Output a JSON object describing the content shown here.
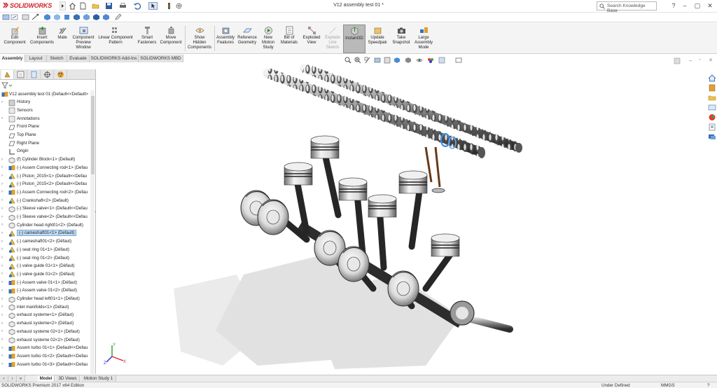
{
  "app": {
    "logo_text": "SOLIDWORKS",
    "document_title": "V12 assembly test 01 *",
    "search_placeholder": "Search Knowledge Base",
    "window_controls": [
      "?",
      "–",
      "▢",
      "✕"
    ]
  },
  "quick_access_icons": [
    "home-icon",
    "new-document-icon",
    "open-icon",
    "save-icon",
    "print-icon",
    "undo-icon",
    "select-icon",
    "rebuild-icon",
    "options-icon"
  ],
  "ribbon": {
    "buttons": [
      {
        "label": "Edit\nComponent",
        "icon": "edit-component-icon",
        "enabled": true
      },
      {
        "label": "Insert\nComponents",
        "icon": "insert-components-icon",
        "enabled": true
      },
      {
        "label": "Mate",
        "icon": "mate-icon",
        "enabled": true
      },
      {
        "label": "Component\nPreview\nWindow",
        "icon": "component-preview-icon",
        "enabled": true
      },
      {
        "label": "Linear Component\nPattern",
        "icon": "linear-pattern-icon",
        "enabled": true
      },
      {
        "label": "Smart\nFasteners",
        "icon": "smart-fasteners-icon",
        "enabled": true
      },
      {
        "label": "Move\nComponent",
        "icon": "move-component-icon",
        "enabled": true
      },
      {
        "label": "Show\nHidden\nComponents",
        "icon": "show-hidden-icon",
        "enabled": true
      },
      {
        "label": "Assembly\nFeatures",
        "icon": "assembly-features-icon",
        "enabled": true
      },
      {
        "label": "Reference\nGeometry",
        "icon": "reference-geometry-icon",
        "enabled": true
      },
      {
        "label": "New\nMotion\nStudy",
        "icon": "motion-study-icon",
        "enabled": true
      },
      {
        "label": "Bill of\nMaterials",
        "icon": "bom-icon",
        "enabled": true
      },
      {
        "label": "Exploded\nView",
        "icon": "exploded-view-icon",
        "enabled": true
      },
      {
        "label": "Explode\nLine\nSketch",
        "icon": "explode-line-icon",
        "enabled": false
      },
      {
        "label": "Instant3D",
        "icon": "instant3d-icon",
        "enabled": true,
        "active": true
      },
      {
        "label": "Update\nSpeedpak",
        "icon": "speedpak-icon",
        "enabled": true
      },
      {
        "label": "Take\nSnapshot",
        "icon": "snapshot-icon",
        "enabled": true
      },
      {
        "label": "Large\nAssembly\nMode",
        "icon": "large-assembly-icon",
        "enabled": true
      }
    ]
  },
  "command_tabs": [
    {
      "label": "Assembly",
      "active": true
    },
    {
      "label": "Layout",
      "active": false
    },
    {
      "label": "Sketch",
      "active": false
    },
    {
      "label": "Evaluate",
      "active": false
    },
    {
      "label": "SOLIDWORKS Add-Ins",
      "active": false
    },
    {
      "label": "SOLIDWORKS MBD",
      "active": false
    }
  ],
  "feature_tree": {
    "root": "V12 assembly test 01  (Default<<Default>",
    "items": [
      {
        "label": "History",
        "icon": "history-folder-icon",
        "expand": true
      },
      {
        "label": "Sensors",
        "icon": "sensors-icon",
        "expand": false
      },
      {
        "label": "Annotations",
        "icon": "annotations-icon",
        "expand": true
      },
      {
        "label": "Front Plane",
        "icon": "plane-icon",
        "expand": false
      },
      {
        "label": "Top Plane",
        "icon": "plane-icon",
        "expand": false
      },
      {
        "label": "Right Plane",
        "icon": "plane-icon",
        "expand": false
      },
      {
        "label": "Origin",
        "icon": "origin-icon",
        "expand": false
      },
      {
        "label": "(f) Cylinder Block<1> (Default)",
        "icon": "part-icon",
        "expand": true
      },
      {
        "label": "(-) Assem Connecting rod<1> (Defau",
        "icon": "assembly-icon",
        "expand": true
      },
      {
        "label": "(-) Piston_2015<1> (Default<<Defau",
        "icon": "part-warning-icon",
        "expand": true
      },
      {
        "label": "(-) Piston_2015<2> (Default<<Defau",
        "icon": "part-warning-icon",
        "expand": true
      },
      {
        "label": "(-) Assem Connecting rod<2> (Defau",
        "icon": "assembly-icon",
        "expand": true
      },
      {
        "label": "(-) Crankshaft<2> (Default)",
        "icon": "part-warning-icon",
        "expand": true
      },
      {
        "label": "(-) Sleeve valve<1> (Default<<Defau",
        "icon": "part-icon",
        "expand": true
      },
      {
        "label": "(-) Sleeve valve<2> (Default<<Defau",
        "icon": "part-icon",
        "expand": true
      },
      {
        "label": "Cylinder head right01<2> (Default)",
        "icon": "part-icon",
        "expand": true
      },
      {
        "label": "(-) cameshaft01<1> (Default)",
        "icon": "part-warning-icon",
        "expand": true,
        "selected": true
      },
      {
        "label": "(-) cameshaft01<2> (Défaut)",
        "icon": "part-warning-icon",
        "expand": true
      },
      {
        "label": "(-) seat ring 01<1> (Défaut)",
        "icon": "part-warning-icon",
        "expand": true
      },
      {
        "label": "(-) seat ring 01<2> (Défaut)",
        "icon": "part-warning-icon",
        "expand": true
      },
      {
        "label": "(-) valve guide 01<1> (Défaut)",
        "icon": "part-warning-icon",
        "expand": true
      },
      {
        "label": "(-) valve guide 01<2> (Défaut)",
        "icon": "part-warning-icon",
        "expand": true
      },
      {
        "label": "(-) Assem valve 01<1> (Défaut)",
        "icon": "assembly-icon",
        "expand": true
      },
      {
        "label": "(-) Assem valve 01<2> (Défaut)",
        "icon": "assembly-icon",
        "expand": true
      },
      {
        "label": "Cylinder head left01<1> (Défaut)",
        "icon": "part-icon",
        "expand": true
      },
      {
        "label": "inlet manifolds<1> (Défaut)",
        "icon": "part-icon",
        "expand": true
      },
      {
        "label": "exhaust systeme<1> (Défaut)",
        "icon": "part-icon",
        "expand": true
      },
      {
        "label": "exhaust systeme<2> (Défaut)",
        "icon": "part-icon",
        "expand": true
      },
      {
        "label": "exhaust systeme 02<1> (Défaut)",
        "icon": "part-icon",
        "expand": true
      },
      {
        "label": "exhaust systeme 02<2> (Défaut)",
        "icon": "part-icon",
        "expand": true
      },
      {
        "label": "Assem turbo 01<1> (Default<<Defau",
        "icon": "assembly-icon",
        "expand": true
      },
      {
        "label": "Assem turbo 01<2> (Default<<Defau",
        "icon": "assembly-icon",
        "expand": true
      },
      {
        "label": "Assem turbo 01<3> (Default<<Defau",
        "icon": "assembly-icon",
        "expand": true
      }
    ]
  },
  "bottom_tabs": [
    {
      "label": "Model",
      "active": true
    },
    {
      "label": "3D Views",
      "active": false
    },
    {
      "label": "Motion Study 1",
      "active": false
    }
  ],
  "status": {
    "product": "SOLIDWORKS Premium 2017 x64 Edition",
    "definition": "Under Defined",
    "units": "MMGS",
    "help": "?"
  },
  "colors": {
    "brand": "#d2232a",
    "selection": "#c4ddf4",
    "ribbon_bg": "#f4f4f4",
    "piston": "#e8e8e8",
    "metal_dark": "#2d2d2d"
  }
}
